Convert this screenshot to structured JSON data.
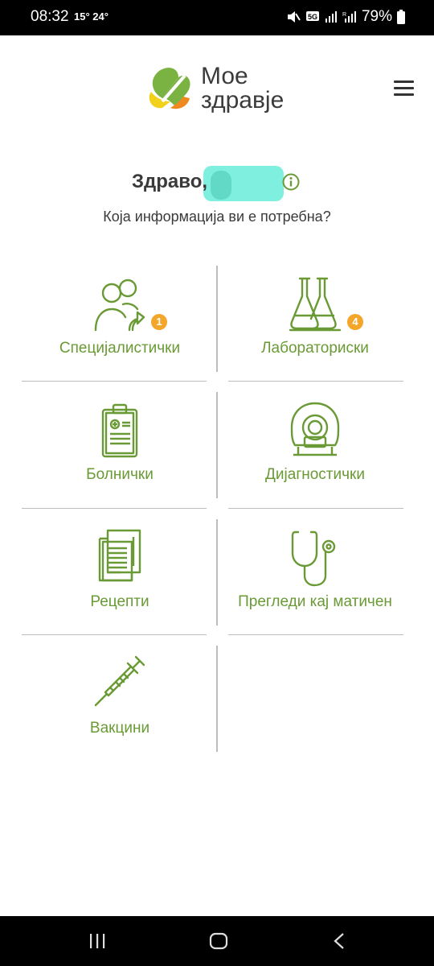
{
  "status_bar": {
    "time": "08:32",
    "weather": "15° 24°",
    "battery": "79%",
    "network_label": "5G"
  },
  "header": {
    "app_name_line1": "Мое",
    "app_name_line2": "здравје",
    "menu_icon": "hamburger-menu-icon"
  },
  "greeting": {
    "hello": "Здраво,",
    "question": "Која информација ви е потребна?"
  },
  "tiles": [
    {
      "label": "Специјалистички",
      "icon": "specialist-doctors-icon",
      "badge": "1"
    },
    {
      "label": "Лабораториски",
      "icon": "laboratory-flasks-icon",
      "badge": "4"
    },
    {
      "label": "Болнички",
      "icon": "clipboard-icon",
      "badge": ""
    },
    {
      "label": "Дијагностички",
      "icon": "scanner-icon",
      "badge": ""
    },
    {
      "label": "Рецепти",
      "icon": "prescriptions-icon",
      "badge": ""
    },
    {
      "label": "Прегледи кај матичен",
      "icon": "stethoscope-icon",
      "badge": ""
    },
    {
      "label": "Вакцини",
      "icon": "syringe-icon",
      "badge": ""
    }
  ],
  "colors": {
    "accent_green": "#6a9a35",
    "badge_orange": "#f3a629",
    "logo_green": "#7ab341",
    "logo_yellow": "#f1d11a",
    "logo_orange": "#f08a1e"
  }
}
